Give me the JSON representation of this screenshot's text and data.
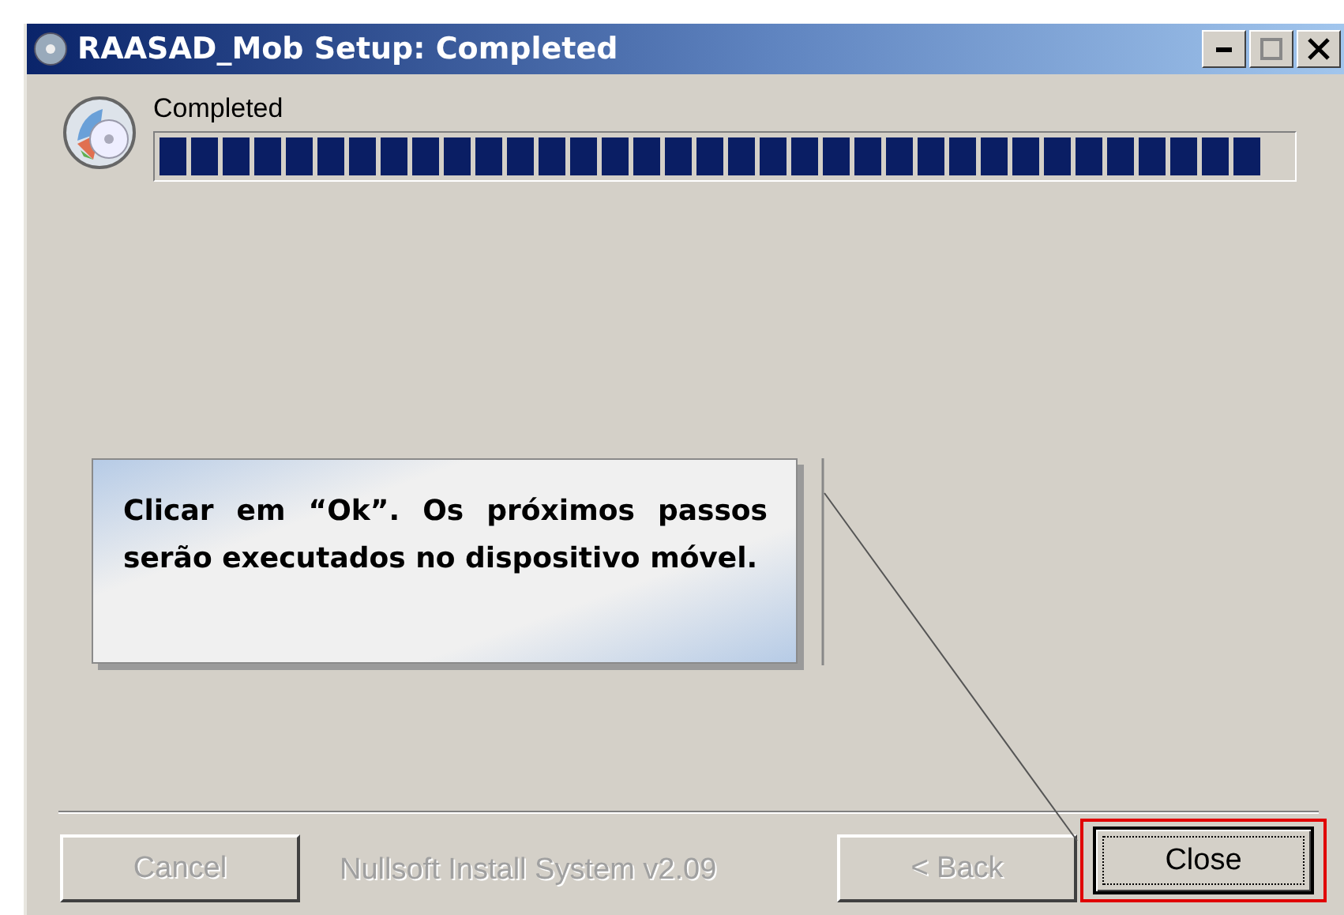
{
  "window": {
    "title": "RAASAD_Mob Setup: Completed",
    "controls": [
      {
        "kind": "minimize"
      },
      {
        "kind": "maximize"
      },
      {
        "kind": "close"
      }
    ]
  },
  "status": {
    "text": "Completed",
    "progress": {
      "level": 1
    }
  },
  "callout": {
    "text": "Clicar em “Ok”. Os próximos passos serão executados no dispositivo móvel."
  },
  "branding": "Nullsoft Install System v2.09",
  "buttons": [
    {
      "label": "Cancel",
      "disabled": true,
      "focused": false,
      "highlighted": false
    },
    {
      "label": "< Back",
      "disabled": true,
      "focused": false,
      "highlighted": false
    },
    {
      "label": "Close",
      "disabled": false,
      "focused": true,
      "highlighted": true
    }
  ]
}
